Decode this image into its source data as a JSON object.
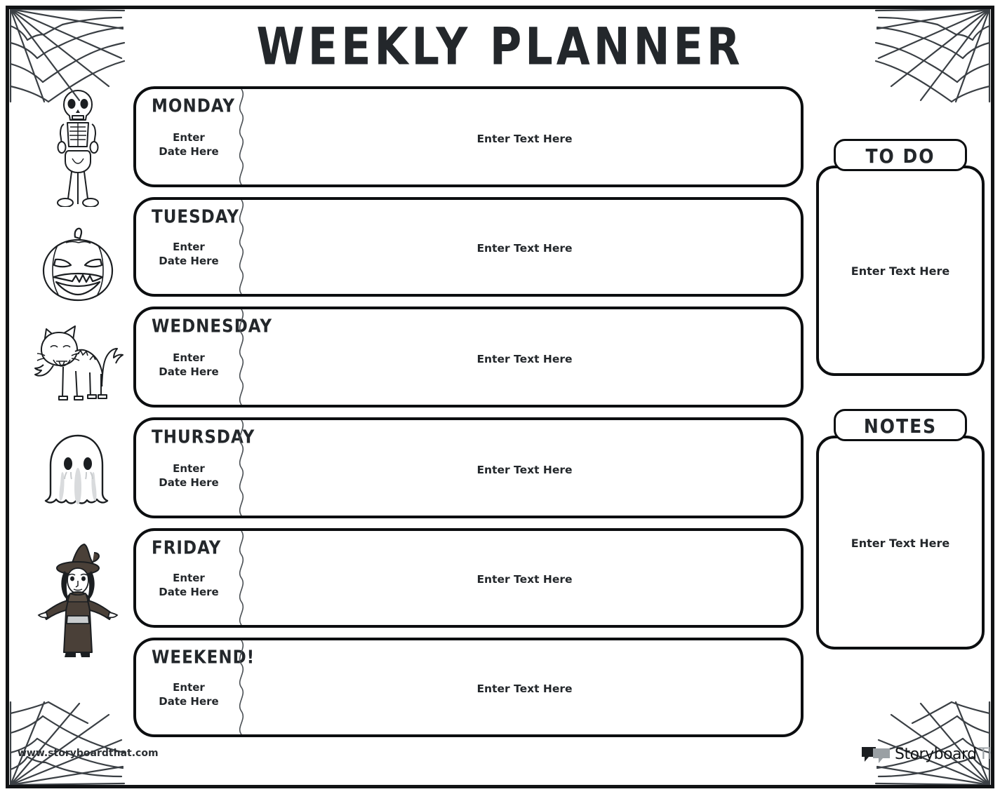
{
  "page": {
    "title": "WEEKLY PLANNER",
    "background_color": "#ffffff",
    "ink_color": "#0c0e10",
    "text_color": "#23272b"
  },
  "days": [
    {
      "name": "MONDAY",
      "date_placeholder": "Enter\nDate Here",
      "text_placeholder": "Enter Text Here"
    },
    {
      "name": "TUESDAY",
      "date_placeholder": "Enter\nDate Here",
      "text_placeholder": "Enter Text Here"
    },
    {
      "name": "WEDNESDAY",
      "date_placeholder": "Enter\nDate Here",
      "text_placeholder": "Enter Text Here"
    },
    {
      "name": "THURSDAY",
      "date_placeholder": "Enter\nDate Here",
      "text_placeholder": "Enter Text Here"
    },
    {
      "name": "FRIDAY",
      "date_placeholder": "Enter\nDate Here",
      "text_placeholder": "Enter Text Here"
    },
    {
      "name": "WEEKEND!",
      "date_placeholder": "Enter\nDate Here",
      "text_placeholder": "Enter Text Here"
    }
  ],
  "panels": [
    {
      "title": "TO DO",
      "text_placeholder": "Enter Text Here"
    },
    {
      "title": "NOTES",
      "text_placeholder": "Enter Text Here"
    }
  ],
  "decorations": {
    "icons": [
      {
        "name": "skeleton-icon"
      },
      {
        "name": "pumpkin-icon"
      },
      {
        "name": "black-cat-icon"
      },
      {
        "name": "ghost-icon"
      },
      {
        "name": "witch-icon"
      }
    ],
    "spiderwebs": [
      {
        "name": "spiderweb-top-left-icon"
      },
      {
        "name": "spiderweb-top-right-icon"
      },
      {
        "name": "spiderweb-bottom-left-icon"
      },
      {
        "name": "spiderweb-bottom-right-icon"
      }
    ]
  },
  "branding": {
    "watermark_url": "www.storyboardthat.com",
    "logo_word_primary": "Storyboard",
    "logo_word_secondary": "That"
  }
}
